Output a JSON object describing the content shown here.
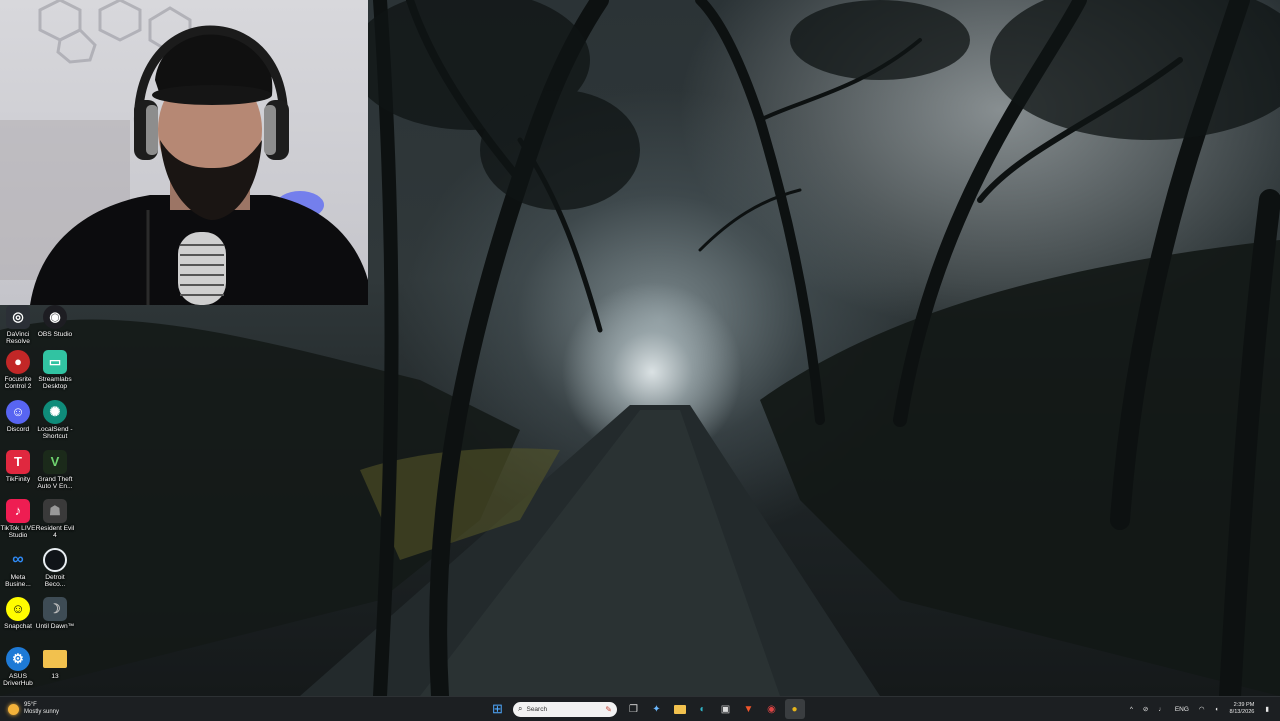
{
  "desktop": {
    "icons": [
      {
        "label": "DaVinci Resolve",
        "icon": "davinci-resolve-icon",
        "color": "#2b2f36"
      },
      {
        "label": "OBS Studio",
        "icon": "obs-studio-icon",
        "color": "#1d1d22"
      },
      {
        "label": "Focusrite Control 2",
        "icon": "focusrite-icon",
        "color": "#c22727"
      },
      {
        "label": "Streamlabs Desktop",
        "icon": "streamlabs-icon",
        "color": "#31c3a2"
      },
      {
        "label": "Discord",
        "icon": "discord-icon",
        "color": "#5865f2"
      },
      {
        "label": "LocalSend - Shortcut",
        "icon": "localsend-icon",
        "color": "#0f8c7a"
      },
      {
        "label": "TikFinity",
        "icon": "tikfinity-icon",
        "color": "#e0283f"
      },
      {
        "label": "Grand Theft Auto V En...",
        "icon": "gta-v-icon",
        "color": "#1b2a1a"
      },
      {
        "label": "TikTok LIVE Studio",
        "icon": "tiktok-live-studio-icon",
        "color": "#ee1d52"
      },
      {
        "label": "Resident Evil 4",
        "icon": "resident-evil-4-icon",
        "color": "#3a3a3a"
      },
      {
        "label": "Meta Busine...",
        "icon": "meta-business-icon",
        "color": "#0a66d8"
      },
      {
        "label": "Detroit Beco...",
        "icon": "detroit-become-human-icon",
        "color": "#e9eef2"
      },
      {
        "label": "Snapchat",
        "icon": "snapchat-icon",
        "color": "#fffc00"
      },
      {
        "label": "Until Dawn™",
        "icon": "until-dawn-icon",
        "color": "#3e4c55"
      },
      {
        "label": "ASUS DriverHub",
        "icon": "asus-driverhub-icon",
        "color": "#1e7ad6"
      },
      {
        "label": "13",
        "icon": "folder-icon",
        "color": "#f2c14e"
      }
    ]
  },
  "taskbar": {
    "weather": {
      "temp": "95°F",
      "condition": "Mostly sunny"
    },
    "search_placeholder": "Search",
    "pinned": [
      {
        "name": "start-button",
        "icon": "windows-start-icon",
        "glyph": "⊞",
        "color": "#4fa9ff"
      },
      {
        "name": "task-view-button",
        "icon": "task-view-icon",
        "glyph": "❐",
        "color": "#dcdcdc"
      },
      {
        "name": "copilot-button",
        "icon": "copilot-icon",
        "glyph": "✦",
        "color": "#6bb8ff"
      },
      {
        "name": "file-explorer-button",
        "icon": "folder-icon",
        "glyph": "▬",
        "color": "#f2c14e"
      },
      {
        "name": "edge-button",
        "icon": "edge-icon",
        "glyph": "◐",
        "color": "#2fb5c8"
      },
      {
        "name": "store-button",
        "icon": "store-icon",
        "glyph": "▣",
        "color": "#dcdcdc"
      },
      {
        "name": "brave-button",
        "icon": "brave-icon",
        "glyph": "▼",
        "color": "#f0552b"
      },
      {
        "name": "obs-button",
        "icon": "obs-icon",
        "glyph": "◉",
        "color": "#d44"
      },
      {
        "name": "chrome-button",
        "icon": "chrome-icon",
        "glyph": "●",
        "color": "#e6b41a"
      }
    ],
    "tray": {
      "chevron": "^",
      "language": "ENG",
      "time": "2:39 PM",
      "date": "8/13/2026"
    }
  }
}
